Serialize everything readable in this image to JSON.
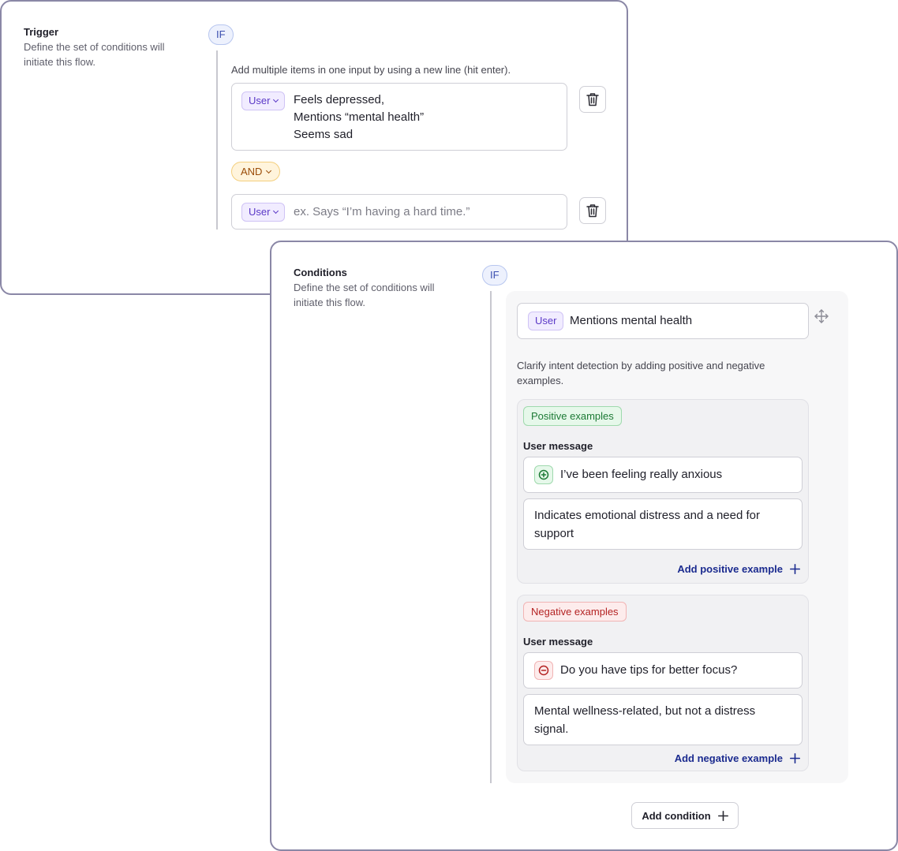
{
  "trigger": {
    "title": "Trigger",
    "description": "Define the set of conditions will initiate this flow.",
    "if_label": "IF",
    "hint": "Add multiple items in one input by using a new line (hit enter).",
    "first_input": {
      "role": "User",
      "lines": [
        "Feels depressed,",
        "Mentions “mental health”",
        "Seems sad"
      ]
    },
    "and_label": "AND",
    "second_input": {
      "role": "User",
      "placeholder": "ex. Says “I’m having a hard time.”"
    }
  },
  "conditions": {
    "title": "Conditions",
    "description": "Define the set of conditions will initiate this flow.",
    "if_label": "IF",
    "condition": {
      "role": "User",
      "text": "Mentions mental health"
    },
    "clarify_hint": "Clarify intent detection by adding positive and negative examples.",
    "positive": {
      "tag": "Positive examples",
      "label": "User message",
      "message": "I’ve been feeling really anxious",
      "reason": "Indicates emotional distress and a need for support",
      "add_label": "Add positive example"
    },
    "negative": {
      "tag": "Negative examples",
      "label": "User message",
      "message": "Do you have tips for better focus?",
      "reason": "Mental wellness-related, but not a distress signal.",
      "add_label": "Add negative example"
    },
    "add_condition_label": "Add condition"
  },
  "colors": {
    "card_border": "#8a87a6",
    "if_blue": "#3c4fb0",
    "user_purple": "#5a38c7",
    "and_orange": "#9a4b07",
    "positive_green": "#1c7a35",
    "negative_red": "#b42323",
    "link_blue": "#1b2b8f"
  }
}
